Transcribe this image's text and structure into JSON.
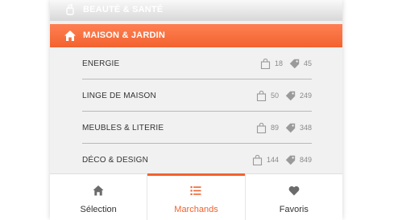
{
  "colors": {
    "accent": "#f2622f",
    "icon_grey": "#9a9a9a",
    "text": "#333333"
  },
  "previous_category": {
    "label": "BEAUTÉ & SANTÉ",
    "icon": "bottle-icon"
  },
  "active_category": {
    "label": "MAISON & JARDIN",
    "icon": "home-icon"
  },
  "subcategories": [
    {
      "label": "ENERGIE",
      "merchants": "18",
      "offers": "45"
    },
    {
      "label": "LINGE DE MAISON",
      "merchants": "50",
      "offers": "249"
    },
    {
      "label": "MEUBLES & LITERIE",
      "merchants": "89",
      "offers": "348"
    },
    {
      "label": "DÉCO & DESIGN",
      "merchants": "144",
      "offers": "849"
    }
  ],
  "tabbar": {
    "tabs": [
      {
        "label": "Sélection",
        "icon": "home-icon",
        "active": false
      },
      {
        "label": "Marchands",
        "icon": "list-icon",
        "active": true
      },
      {
        "label": "Favoris",
        "icon": "heart-icon",
        "active": false
      }
    ]
  }
}
